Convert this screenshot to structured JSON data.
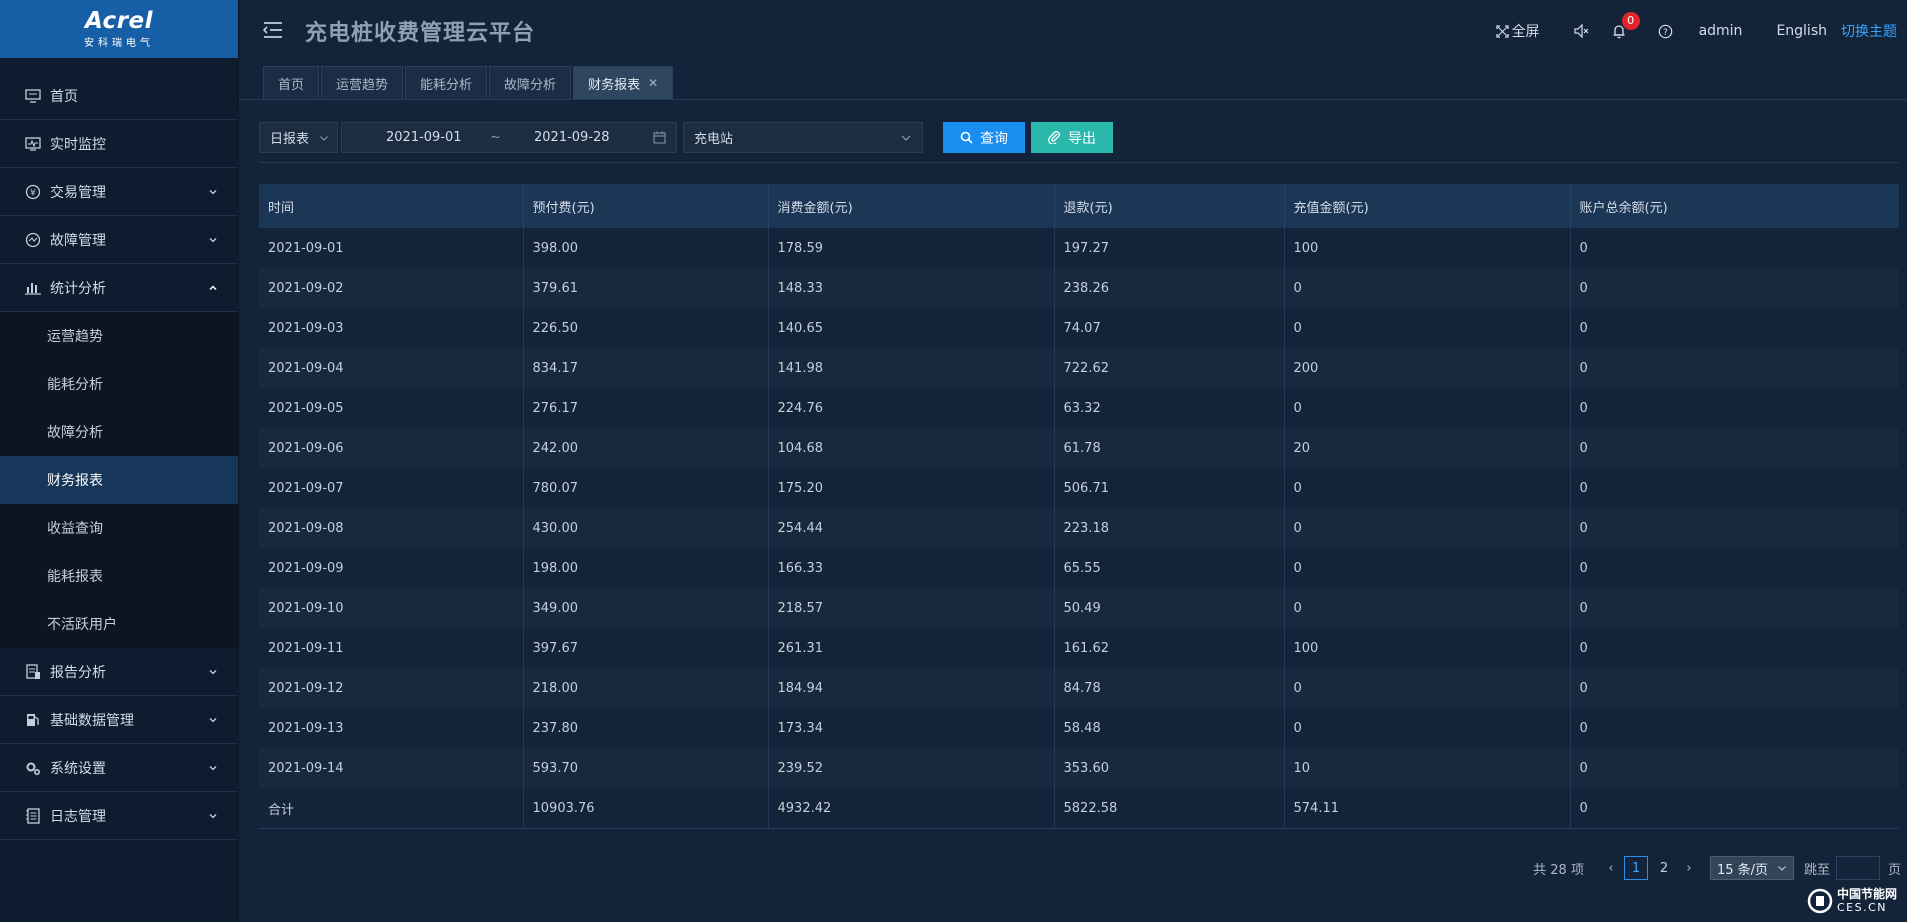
{
  "brand": {
    "logo_text": "Acrel",
    "logo_sub": "安科瑞电气"
  },
  "header": {
    "title": "充电桩收费管理云平台",
    "fullscreen_label": "全屏",
    "notification_count": "0",
    "user": "admin",
    "language": "English",
    "switch_theme": "切换主题"
  },
  "sidebar": {
    "items": [
      {
        "label": "首页",
        "icon": "home-icon"
      },
      {
        "label": "实时监控",
        "icon": "monitor-icon"
      },
      {
        "label": "交易管理",
        "icon": "money-icon"
      },
      {
        "label": "故障管理",
        "icon": "fault-icon"
      },
      {
        "label": "统计分析",
        "icon": "stats-icon"
      },
      {
        "label": "报告分析",
        "icon": "report-icon"
      },
      {
        "label": "基础数据管理",
        "icon": "fuel-icon"
      },
      {
        "label": "系统设置",
        "icon": "gear-icon"
      },
      {
        "label": "日志管理",
        "icon": "log-icon"
      }
    ],
    "sub_items": [
      "运营趋势",
      "能耗分析",
      "故障分析",
      "财务报表",
      "收益查询",
      "能耗报表",
      "不活跃用户"
    ],
    "active_sub": "财务报表"
  },
  "tabs": [
    {
      "label": "首页"
    },
    {
      "label": "运营趋势"
    },
    {
      "label": "能耗分析"
    },
    {
      "label": "故障分析"
    },
    {
      "label": "财务报表",
      "active": true
    }
  ],
  "filters": {
    "report_type": "日报表",
    "date_start": "2021-09-01",
    "date_sep": "~",
    "date_end": "2021-09-28",
    "station": "充电站",
    "query_label": "查询",
    "export_label": "导出"
  },
  "table": {
    "columns": [
      "时间",
      "预付费(元)",
      "消费金额(元)",
      "退款(元)",
      "充值金额(元)",
      "账户总余额(元)"
    ],
    "rows": [
      [
        "2021-09-01",
        "398.00",
        "178.59",
        "197.27",
        "100",
        "0"
      ],
      [
        "2021-09-02",
        "379.61",
        "148.33",
        "238.26",
        "0",
        "0"
      ],
      [
        "2021-09-03",
        "226.50",
        "140.65",
        "74.07",
        "0",
        "0"
      ],
      [
        "2021-09-04",
        "834.17",
        "141.98",
        "722.62",
        "200",
        "0"
      ],
      [
        "2021-09-05",
        "276.17",
        "224.76",
        "63.32",
        "0",
        "0"
      ],
      [
        "2021-09-06",
        "242.00",
        "104.68",
        "61.78",
        "20",
        "0"
      ],
      [
        "2021-09-07",
        "780.07",
        "175.20",
        "506.71",
        "0",
        "0"
      ],
      [
        "2021-09-08",
        "430.00",
        "254.44",
        "223.18",
        "0",
        "0"
      ],
      [
        "2021-09-09",
        "198.00",
        "166.33",
        "65.55",
        "0",
        "0"
      ],
      [
        "2021-09-10",
        "349.00",
        "218.57",
        "50.49",
        "0",
        "0"
      ],
      [
        "2021-09-11",
        "397.67",
        "261.31",
        "161.62",
        "100",
        "0"
      ],
      [
        "2021-09-12",
        "218.00",
        "184.94",
        "84.78",
        "0",
        "0"
      ],
      [
        "2021-09-13",
        "237.80",
        "173.34",
        "58.48",
        "0",
        "0"
      ],
      [
        "2021-09-14",
        "593.70",
        "239.52",
        "353.60",
        "10",
        "0"
      ]
    ],
    "total": [
      "合计",
      "10903.76",
      "4932.42",
      "5822.58",
      "574.11",
      "0"
    ]
  },
  "pagination": {
    "total_text": "共 28 项",
    "pages": [
      "1",
      "2"
    ],
    "current": "1",
    "page_size": "15 条/页",
    "jump_label": "跳至",
    "page_label": "页"
  },
  "watermark": {
    "cn": "中国节能网",
    "en": "CES.CN"
  },
  "colors": {
    "accent": "#1a8ef0",
    "export": "#2ab8ad",
    "logo_bg": "#165fa6",
    "badge": "#e0262c"
  }
}
